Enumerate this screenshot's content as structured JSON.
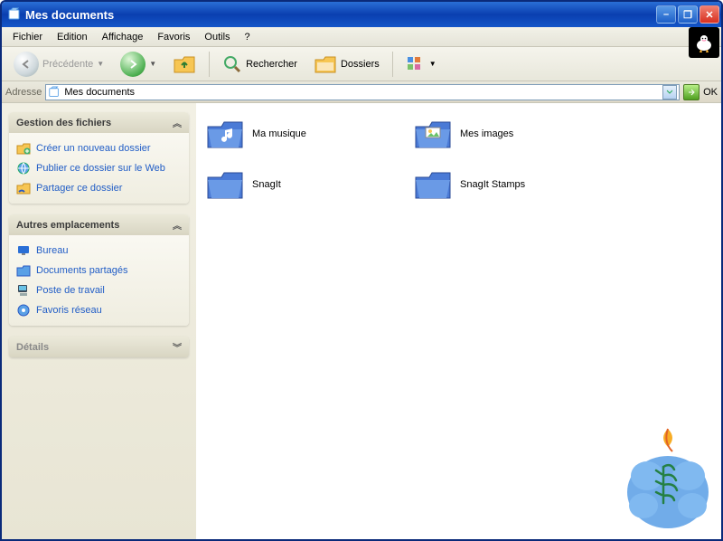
{
  "window": {
    "title": "Mes documents"
  },
  "menu": {
    "file": "Fichier",
    "edit": "Edition",
    "view": "Affichage",
    "favorites": "Favoris",
    "tools": "Outils",
    "help": "?"
  },
  "toolbar": {
    "back": "Précédente",
    "search": "Rechercher",
    "folders": "Dossiers"
  },
  "address": {
    "label": "Adresse",
    "value": "Mes documents",
    "go": "OK"
  },
  "sidebar": {
    "file_tasks": {
      "title": "Gestion des fichiers",
      "items": [
        "Créer un nouveau dossier",
        "Publier ce dossier sur le Web",
        "Partager ce dossier"
      ]
    },
    "other_places": {
      "title": "Autres emplacements",
      "items": [
        "Bureau",
        "Documents partagés",
        "Poste de travail",
        "Favoris réseau"
      ]
    },
    "details": {
      "title": "Détails"
    }
  },
  "folders": [
    {
      "name": "Ma musique",
      "kind": "music"
    },
    {
      "name": "Mes images",
      "kind": "pictures"
    },
    {
      "name": "SnagIt",
      "kind": "folder"
    },
    {
      "name": "SnagIt Stamps",
      "kind": "folder"
    }
  ]
}
